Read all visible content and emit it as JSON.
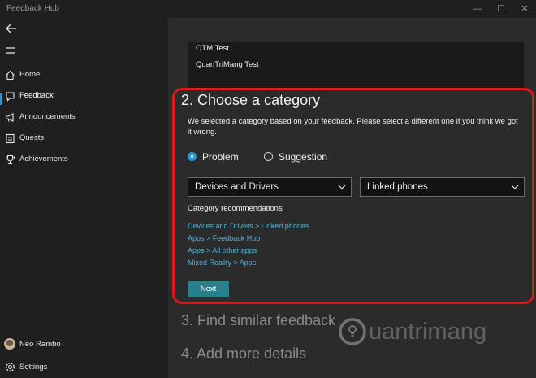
{
  "window": {
    "title": "Feedback Hub",
    "minimize": "—",
    "maximize": "☐",
    "close": "✕"
  },
  "sidebar": {
    "items": [
      {
        "label": "Home",
        "icon": "home-icon"
      },
      {
        "label": "Feedback",
        "icon": "feedback-icon",
        "active": true
      },
      {
        "label": "Announcements",
        "icon": "megaphone-icon"
      },
      {
        "label": "Quests",
        "icon": "quests-icon"
      },
      {
        "label": "Achievements",
        "icon": "trophy-icon"
      }
    ],
    "user": "Neo Rambo",
    "settings": "Settings"
  },
  "main": {
    "previous_items": [
      "OTM Test",
      "QuanTriMang Test"
    ],
    "category_step": {
      "title": "2. Choose a category",
      "description": "We selected a category based on your feedback. Please select a different one if you think we got it wrong.",
      "radio_options": [
        {
          "label": "Problem",
          "checked": true
        },
        {
          "label": "Suggestion",
          "checked": false
        }
      ],
      "category_select": "Devices and Drivers",
      "subcategory_select": "Linked phones",
      "recommendations_heading": "Category recommendations",
      "recommendations": [
        "Devices and Drivers > Linked phones",
        "Apps > Feedback Hub",
        "Apps > All other apps",
        "Mixed Reality > Apps"
      ],
      "next_button": "Next"
    },
    "next_steps": [
      "3. Find similar feedback",
      "4. Add more details"
    ]
  },
  "watermark": {
    "text": "uantrimang"
  },
  "colors": {
    "accent": "#2a9ad6",
    "link": "#4fb3d9",
    "highlight_border": "#e0181d",
    "button": "#2b7f8c"
  }
}
